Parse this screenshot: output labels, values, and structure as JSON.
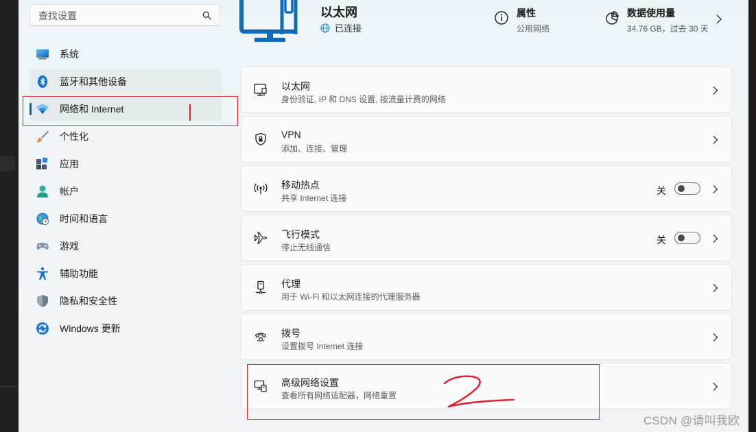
{
  "search": {
    "placeholder": "查找设置",
    "icon": "search-icon"
  },
  "sidebar": {
    "items": [
      {
        "label": "系统",
        "icon": "system-monitor-icon"
      },
      {
        "label": "蓝牙和其他设备",
        "icon": "bluetooth-icon"
      },
      {
        "label": "网络和 Internet",
        "icon": "wifi-icon"
      },
      {
        "label": "个性化",
        "icon": "brush-icon"
      },
      {
        "label": "应用",
        "icon": "apps-icon"
      },
      {
        "label": "帐户",
        "icon": "account-icon"
      },
      {
        "label": "时间和语言",
        "icon": "time-language-icon"
      },
      {
        "label": "游戏",
        "icon": "gamepad-icon"
      },
      {
        "label": "辅助功能",
        "icon": "accessibility-icon"
      },
      {
        "label": "隐私和安全性",
        "icon": "shield-icon"
      },
      {
        "label": "Windows 更新",
        "icon": "update-icon"
      }
    ],
    "active_index": 2
  },
  "header": {
    "title": "以太网",
    "status": "已连接",
    "properties": {
      "title": "属性",
      "sub": "公用网络"
    },
    "data_usage": {
      "title": "数据使用量",
      "sub": "34.76 GB，过去 30 天"
    }
  },
  "rows": [
    {
      "title": "以太网",
      "sub": "身份验证, IP 和 DNS 设置, 按流量计费的网络",
      "icon": "ethernet-icon"
    },
    {
      "title": "VPN",
      "sub": "添加、连接、管理",
      "icon": "vpn-shield-icon"
    },
    {
      "title": "移动热点",
      "sub": "共享 Internet 连接",
      "icon": "hotspot-icon",
      "toggle_label": "关",
      "toggle_on": false
    },
    {
      "title": "飞行模式",
      "sub": "停止无线通信",
      "icon": "airplane-icon",
      "toggle_label": "关",
      "toggle_on": false
    },
    {
      "title": "代理",
      "sub": "用于 Wi-Fi 和以太网连接的代理服务器",
      "icon": "proxy-icon"
    },
    {
      "title": "拨号",
      "sub": "设置拨号 Internet 连接",
      "icon": "dialup-icon"
    },
    {
      "title": "高级网络设置",
      "sub": "查看所有网络适配器，网络重置",
      "icon": "advanced-network-icon"
    }
  ],
  "annotation": {
    "highlight_color": "#e0202a"
  },
  "watermark": "CSDN @请叫我欧皇i",
  "colors": {
    "accent": "#005fb8",
    "annotation": "#e0202a"
  }
}
